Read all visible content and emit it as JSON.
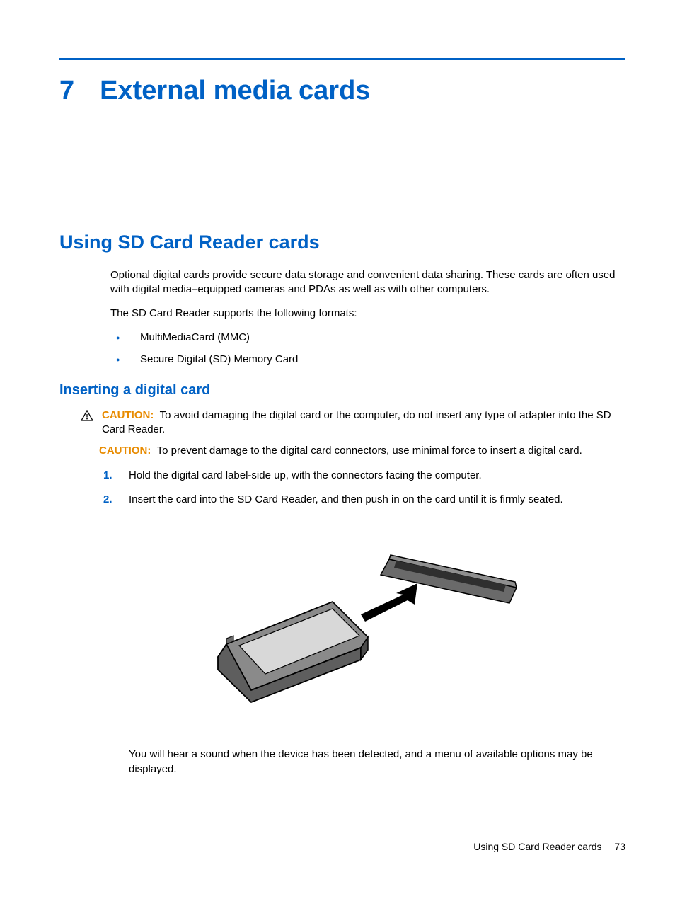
{
  "chapter": {
    "number": "7",
    "title": "External media cards"
  },
  "section": {
    "title": "Using SD Card Reader cards",
    "intro": "Optional digital cards provide secure data storage and convenient data sharing. These cards are often used with digital media–equipped cameras and PDAs as well as with other computers.",
    "supports_line": "The SD Card Reader supports the following formats:",
    "formats": [
      "MultiMediaCard (MMC)",
      "Secure Digital (SD) Memory Card"
    ]
  },
  "subsection": {
    "title": "Inserting a digital card",
    "caution_label": "CAUTION:",
    "caution1": "To avoid damaging the digital card or the computer, do not insert any type of adapter into the SD Card Reader.",
    "caution2": "To prevent damage to the digital card connectors, use minimal force to insert a digital card.",
    "steps": [
      {
        "n": "1.",
        "text": "Hold the digital card label-side up, with the connectors facing the computer."
      },
      {
        "n": "2.",
        "text": "Insert the card into the SD Card Reader, and then push in on the card until it is firmly seated."
      }
    ],
    "post_text": "You will hear a sound when the device has been detected, and a menu of available options may be displayed."
  },
  "footer": {
    "text": "Using SD Card Reader cards",
    "page": "73"
  }
}
